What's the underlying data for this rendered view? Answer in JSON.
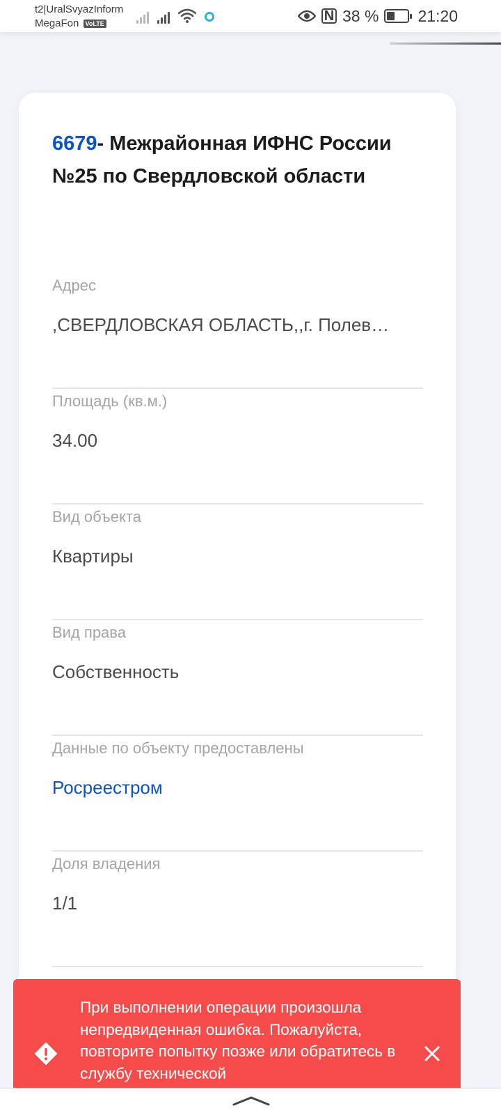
{
  "status_bar": {
    "carrier_line1": "t2|UralSvyazInform",
    "carrier_line2": "MegaFon",
    "volte_badge": "VoLTE",
    "battery_percent": "38 %",
    "battery_level": 0.38,
    "time": "21:20",
    "icons": [
      "signal-icon",
      "signal-icon",
      "wifi-icon",
      "sync-icon",
      "eye-icon",
      "nfc-icon",
      "battery-icon"
    ]
  },
  "card": {
    "title_code": "6679",
    "title_text": "- Межрайонная ИФНС России №25 по Свердловской области",
    "fields": [
      {
        "label": "Адрес",
        "value": ",СВЕРДЛОВСКАЯ ОБЛАСТЬ,,г. Полев…"
      },
      {
        "label": "Площадь (кв.м.)",
        "value": "34.00"
      },
      {
        "label": "Вид объекта",
        "value": "Квартиры"
      },
      {
        "label": "Вид права",
        "value": "Собственность"
      },
      {
        "label": "Данные по объекту предоставлены",
        "value": "Росреестром"
      },
      {
        "label": "Доля владения",
        "value": "1/1"
      }
    ]
  },
  "error_toast": {
    "message": "При выполнении операции произошла непредвиденная ошибка. Пожалуйста, повторите попытку позже или обратитесь в службу технической",
    "icon": "warning-diamond-icon",
    "close_icon": "close-icon",
    "color": "#f64b4b"
  },
  "accent_color": "#0d53c5"
}
